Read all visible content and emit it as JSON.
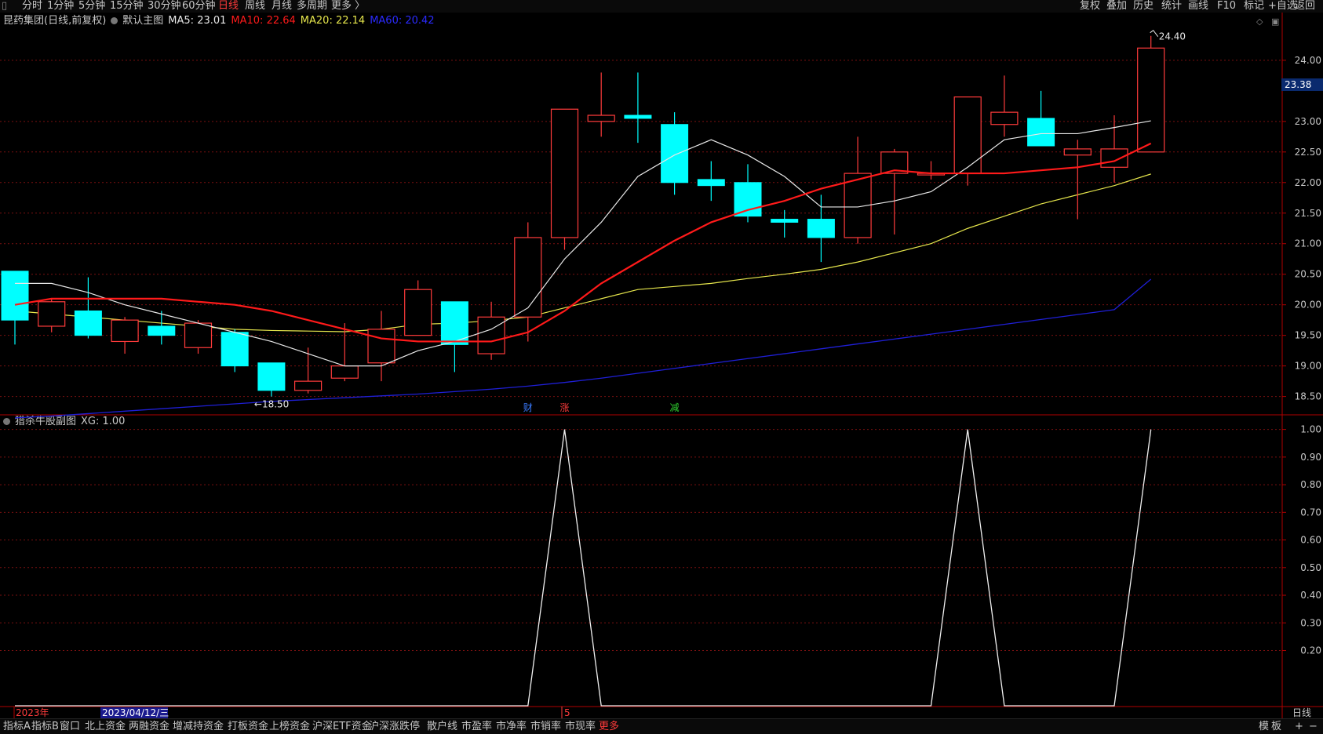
{
  "top_menu": {
    "left": [
      {
        "label": "分时"
      },
      {
        "label": "1分钟"
      },
      {
        "label": "5分钟"
      },
      {
        "label": "15分钟"
      },
      {
        "label": "30分钟"
      },
      {
        "label": "60分钟"
      },
      {
        "label": "日线",
        "active": true
      },
      {
        "label": "周线"
      },
      {
        "label": "月线"
      },
      {
        "label": "多周期"
      },
      {
        "label": "更多 〉"
      }
    ],
    "right": [
      {
        "label": "复权"
      },
      {
        "label": "叠加"
      },
      {
        "label": "历史"
      },
      {
        "label": "统计"
      },
      {
        "label": "画线"
      },
      {
        "label": "F10"
      },
      {
        "label": "标记"
      },
      {
        "label": "+自选"
      },
      {
        "label": "返回"
      }
    ]
  },
  "main_legend": {
    "stock": "昆药集团(日线,前复权)",
    "indicator": "默认主图",
    "ma5": "MA5: 23.01",
    "ma10": "MA10: 22.64",
    "ma20": "MA20: 22.14",
    "ma60": "MA60: 20.42"
  },
  "sub_legend": {
    "name": "猎杀牛股副图",
    "value": "XG: 1.00"
  },
  "current_price_tag": "23.38",
  "colors": {
    "up": "#ff3b3b",
    "down": "#00ffff",
    "ma5": "#e8e8e8",
    "ma10": "#ff1a1a",
    "ma20": "#e6e64c",
    "ma60": "#1f1fd6",
    "grid": "#7a1010",
    "axis": "#b00000"
  },
  "chart_data": [
    {
      "type": "candlestick",
      "y_ticks": [
        18.5,
        19.0,
        19.5,
        20.0,
        20.5,
        21.0,
        21.5,
        22.0,
        22.5,
        23.0,
        24.0
      ],
      "y_tick_labels": [
        "18.50",
        "19.00",
        "19.50",
        "20.00",
        "20.50",
        "21.00",
        "21.50",
        "22.00",
        "22.50",
        "23.00",
        "24.00"
      ],
      "ylim": [
        18.2,
        24.55
      ],
      "candles": [
        {
          "o": 20.55,
          "c": 19.75,
          "h": 20.55,
          "l": 19.35
        },
        {
          "o": 19.65,
          "c": 20.05,
          "h": 20.1,
          "l": 19.55
        },
        {
          "o": 19.9,
          "c": 19.5,
          "h": 20.45,
          "l": 19.45
        },
        {
          "o": 19.4,
          "c": 19.75,
          "h": 19.8,
          "l": 19.2
        },
        {
          "o": 19.65,
          "c": 19.5,
          "h": 19.9,
          "l": 19.35
        },
        {
          "o": 19.3,
          "c": 19.7,
          "h": 19.75,
          "l": 19.2
        },
        {
          "o": 19.55,
          "c": 19.0,
          "h": 19.6,
          "l": 18.9
        },
        {
          "o": 19.05,
          "c": 18.6,
          "h": 19.05,
          "l": 18.5
        },
        {
          "o": 18.6,
          "c": 18.75,
          "h": 19.3,
          "l": 18.55
        },
        {
          "o": 18.8,
          "c": 19.0,
          "h": 19.7,
          "l": 18.75
        },
        {
          "o": 19.05,
          "c": 19.6,
          "h": 19.9,
          "l": 18.75
        },
        {
          "o": 19.5,
          "c": 20.25,
          "h": 20.4,
          "l": 19.5
        },
        {
          "o": 20.05,
          "c": 19.35,
          "h": 20.05,
          "l": 18.9
        },
        {
          "o": 19.2,
          "c": 19.8,
          "h": 20.05,
          "l": 19.1
        },
        {
          "o": 19.8,
          "c": 21.1,
          "h": 21.35,
          "l": 19.4
        },
        {
          "o": 21.1,
          "c": 23.2,
          "h": 23.2,
          "l": 20.9
        },
        {
          "o": 23.0,
          "c": 23.1,
          "h": 23.8,
          "l": 22.75
        },
        {
          "o": 23.1,
          "c": 23.05,
          "h": 23.8,
          "l": 22.65
        },
        {
          "o": 22.95,
          "c": 22.0,
          "h": 23.15,
          "l": 21.8
        },
        {
          "o": 22.05,
          "c": 21.95,
          "h": 22.35,
          "l": 21.7
        },
        {
          "o": 22.0,
          "c": 21.45,
          "h": 22.3,
          "l": 21.35
        },
        {
          "o": 21.4,
          "c": 21.35,
          "h": 21.55,
          "l": 21.1
        },
        {
          "o": 21.4,
          "c": 21.1,
          "h": 21.8,
          "l": 20.7
        },
        {
          "o": 21.1,
          "c": 22.15,
          "h": 22.75,
          "l": 21.0
        },
        {
          "o": 22.15,
          "c": 22.5,
          "h": 22.55,
          "l": 21.15
        },
        {
          "o": 22.15,
          "c": 22.15,
          "h": 22.35,
          "l": 22.05
        },
        {
          "o": 22.15,
          "c": 23.4,
          "h": 23.4,
          "l": 21.95
        },
        {
          "o": 22.95,
          "c": 23.15,
          "h": 23.75,
          "l": 22.75
        },
        {
          "o": 23.05,
          "c": 22.6,
          "h": 23.5,
          "l": 22.6
        },
        {
          "o": 22.45,
          "c": 22.55,
          "h": 22.7,
          "l": 21.4
        },
        {
          "o": 22.25,
          "c": 22.55,
          "h": 23.1,
          "l": 22.0
        },
        {
          "o": 22.5,
          "c": 24.2,
          "h": 24.4,
          "l": 22.5
        }
      ],
      "ma5": [
        20.35,
        20.35,
        20.2,
        20.0,
        19.85,
        19.7,
        19.55,
        19.4,
        19.2,
        19.0,
        19.0,
        19.25,
        19.4,
        19.6,
        19.95,
        20.75,
        21.35,
        22.1,
        22.45,
        22.7,
        22.45,
        22.1,
        21.6,
        21.6,
        21.7,
        21.85,
        22.25,
        22.7,
        22.8,
        22.8,
        22.9,
        23.01
      ],
      "ma10": [
        20.0,
        20.1,
        20.1,
        20.1,
        20.1,
        20.05,
        20.0,
        19.9,
        19.75,
        19.6,
        19.45,
        19.4,
        19.4,
        19.4,
        19.55,
        19.9,
        20.35,
        20.7,
        21.05,
        21.35,
        21.55,
        21.7,
        21.9,
        22.05,
        22.2,
        22.15,
        22.15,
        22.15,
        22.2,
        22.25,
        22.35,
        22.64
      ],
      "ma20": [
        19.9,
        19.85,
        19.8,
        19.75,
        19.7,
        19.65,
        19.6,
        19.58,
        19.57,
        19.56,
        19.6,
        19.68,
        19.7,
        19.74,
        19.8,
        19.95,
        20.1,
        20.25,
        20.3,
        20.35,
        20.43,
        20.5,
        20.58,
        20.7,
        20.85,
        21.0,
        21.25,
        21.45,
        21.65,
        21.8,
        21.95,
        22.14
      ],
      "ma60": [
        18.15,
        18.18,
        18.22,
        18.26,
        18.3,
        18.34,
        18.38,
        18.42,
        18.45,
        18.48,
        18.51,
        18.54,
        18.58,
        18.62,
        18.67,
        18.73,
        18.8,
        18.88,
        18.96,
        19.04,
        19.12,
        19.2,
        19.28,
        19.36,
        19.44,
        19.52,
        19.6,
        19.68,
        19.76,
        19.84,
        19.92,
        20.42
      ],
      "annotations": [
        {
          "index": 7,
          "label": "←18.50"
        },
        {
          "index": 31,
          "label": "24.40"
        }
      ],
      "event_markers": [
        {
          "index": 14,
          "label": "财",
          "color": "#3a7bff"
        },
        {
          "index": 15,
          "label": "涨",
          "color": "#ff3b3b"
        },
        {
          "index": 18,
          "label": "减",
          "color": "#2fd12f"
        }
      ]
    },
    {
      "type": "line",
      "name": "XG",
      "y_ticks": [
        0.2,
        0.3,
        0.4,
        0.5,
        0.6,
        0.7,
        0.8,
        0.9,
        1.0
      ],
      "y_tick_labels": [
        "0.20",
        "0.30",
        "0.40",
        "0.50",
        "0.60",
        "0.70",
        "0.80",
        "0.90",
        "1.00"
      ],
      "ylim": [
        0,
        1.05
      ],
      "values": [
        0,
        0,
        0,
        0,
        0,
        0,
        0,
        0,
        0,
        0,
        0,
        0,
        0,
        0,
        0,
        1,
        0,
        0,
        0,
        0,
        0,
        0,
        0,
        0,
        0,
        0,
        1,
        0,
        0,
        0,
        0,
        1
      ]
    }
  ],
  "date_axis": {
    "year_label": "2023年",
    "cursor_date": "2023/04/12/三",
    "month_mark": "5",
    "period": "日线"
  },
  "bottom_tabs": [
    {
      "label": "指标A"
    },
    {
      "label": "指标B"
    },
    {
      "label": "窗口"
    },
    {
      "label": "北上资金"
    },
    {
      "label": "两融资金"
    },
    {
      "label": "增减持资金"
    },
    {
      "label": "打板资金"
    },
    {
      "label": "上榜资金"
    },
    {
      "label": "沪深ETF资金"
    },
    {
      "label": "沪深涨跌停"
    },
    {
      "label": "散户线"
    },
    {
      "label": "市盈率"
    },
    {
      "label": "市净率"
    },
    {
      "label": "市销率"
    },
    {
      "label": "市现率"
    },
    {
      "label": "更多",
      "active": true
    }
  ],
  "bottom_right": [
    {
      "label": "模"
    },
    {
      "label": "板"
    },
    {
      "label": "+"
    },
    {
      "label": "−"
    }
  ]
}
